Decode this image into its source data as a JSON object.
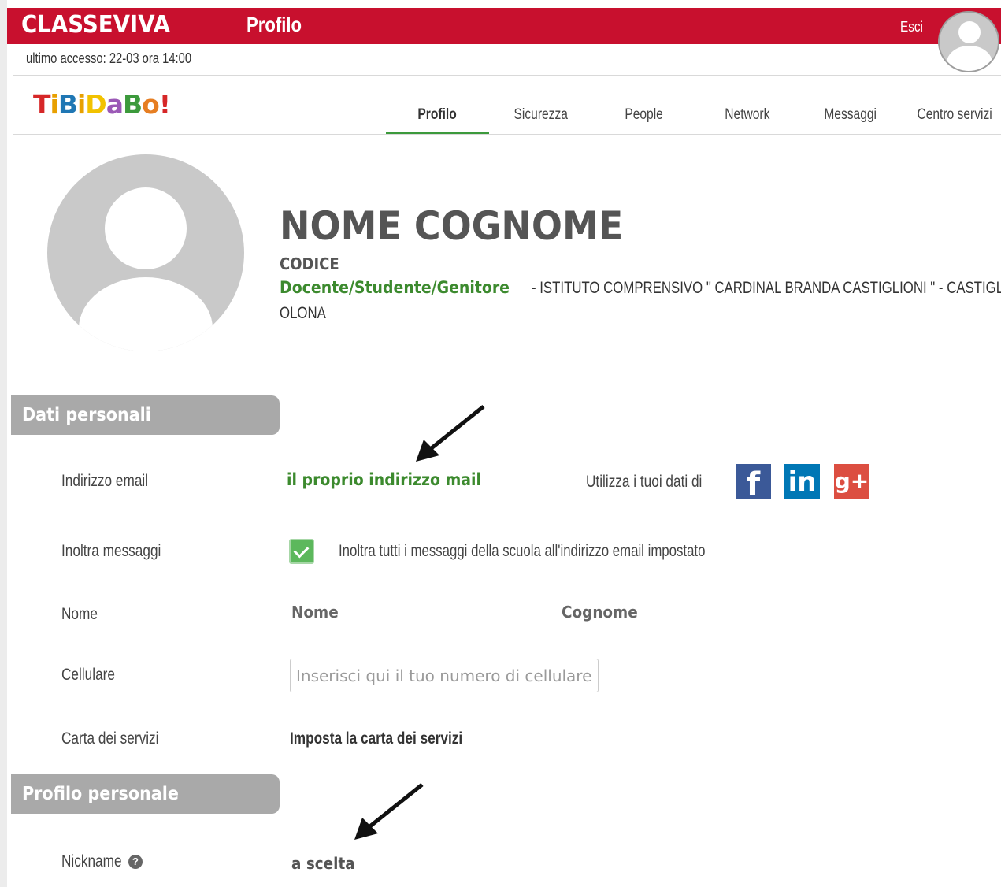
{
  "header": {
    "brand": "CLASSEVIVA",
    "title": "Profilo",
    "logout_label": "Esci",
    "last_access": "ultimo accesso: 22-03 ora 14:00"
  },
  "logo": {
    "letters": [
      "T",
      "i",
      "B",
      "i",
      "D",
      "a",
      "B",
      "o",
      "!"
    ],
    "colors": [
      "#d62728",
      "#e8a000",
      "#1f77b4",
      "#e8a000",
      "#f2c200",
      "#9b59b6",
      "#3c9a3c",
      "#e67e22",
      "#d62728"
    ]
  },
  "tabs": [
    {
      "label": "Profilo",
      "active": true
    },
    {
      "label": "Sicurezza",
      "active": false
    },
    {
      "label": "People",
      "active": false
    },
    {
      "label": "Network",
      "active": false
    },
    {
      "label": "Messaggi",
      "active": false
    },
    {
      "label": "Centro servizi",
      "active": false
    }
  ],
  "profile": {
    "full_name": "NOME COGNOME",
    "code": "CODICE",
    "role": "Docente/Studente/Genitore",
    "school_line1": "- ISTITUTO COMPRENSIVO \" CARDINAL BRANDA CASTIGLIONI \" - CASTIGLIONE",
    "school_line2": "OLONA"
  },
  "personal_data": {
    "section_title": "Dati personali",
    "email_label": "Indirizzo email",
    "email_value": "il proprio indirizzo mail",
    "use_data_label": "Utilizza i tuoi dati di",
    "social": {
      "facebook": "f",
      "linkedin": "in",
      "googleplus": "g+"
    },
    "forward_label": "Inoltra messaggi",
    "forward_checked": true,
    "forward_text": "Inoltra tutti i messaggi della scuola all'indirizzo email impostato",
    "name_label": "Nome",
    "first_name_value": "Nome",
    "last_name_value": "Cognome",
    "phone_label": "Cellulare",
    "phone_placeholder": "Inserisci qui il tuo numero di cellulare",
    "phone_value": "",
    "service_card_label": "Carta dei servizi",
    "service_card_link": "Imposta la carta dei servizi"
  },
  "personal_profile": {
    "section_title": "Profilo personale",
    "nickname_label": "Nickname",
    "help_icon": "?",
    "nickname_value": "a scelta"
  },
  "colors": {
    "brand_red": "#c8102e",
    "accent_green": "#3c8a2e",
    "section_grey": "#a9a9a9"
  }
}
